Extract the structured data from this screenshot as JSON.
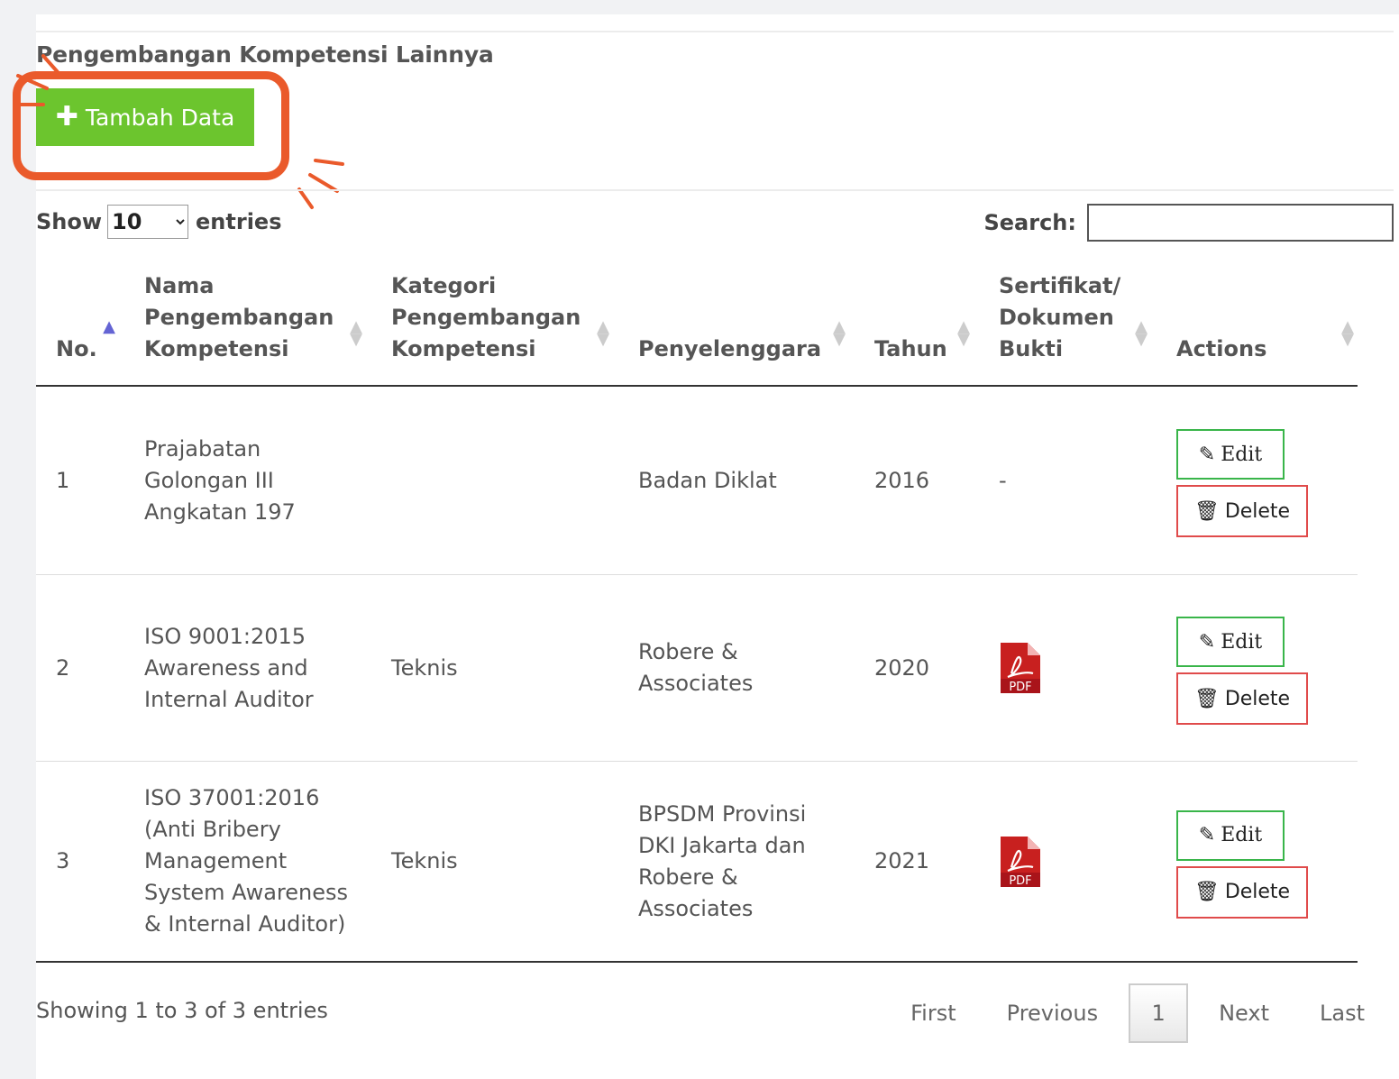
{
  "section": {
    "title": "Pengembangan Kompetensi Lainnya",
    "add_button_label": "Tambah Data",
    "highlight_color": "#ea5a2b",
    "add_button_color": "#6cc52e"
  },
  "controls": {
    "show_label": "Show",
    "entries_label": "entries",
    "page_length": "10",
    "search_label": "Search:",
    "search_value": ""
  },
  "table": {
    "headers": [
      {
        "label": "No.",
        "sort": "asc"
      },
      {
        "label": "Nama Pengembangan Kompetensi",
        "sort": "both"
      },
      {
        "label": "Kategori Pengembangan Kompetensi",
        "sort": "both"
      },
      {
        "label": "Penyelenggara",
        "sort": "both"
      },
      {
        "label": "Tahun",
        "sort": "both"
      },
      {
        "label": "Sertifikat/ Dokumen Bukti",
        "sort": "both"
      },
      {
        "label": "Actions",
        "sort": "both"
      }
    ],
    "rows": [
      {
        "no": "1",
        "nama": "Prajabatan Golongan III Angkatan 197",
        "kategori": "",
        "penyelenggara": "Badan Diklat",
        "tahun": "2016",
        "sertifikat": "-"
      },
      {
        "no": "2",
        "nama": "ISO 9001:2015 Awareness and Internal Auditor",
        "kategori": "Teknis",
        "penyelenggara": "Robere & Associates",
        "tahun": "2020",
        "pdf_label": "PDF"
      },
      {
        "no": "3",
        "nama": "ISO 37001:2016 (Anti Bribery Management System Awareness & Internal Auditor)",
        "kategori": "Teknis",
        "penyelenggara": "BPSDM Provinsi DKI Jakarta dan Robere & Associates",
        "tahun": "2021",
        "pdf_label": "PDF"
      }
    ],
    "edit_label": "Edit",
    "delete_label": "Delete"
  },
  "footer": {
    "info": "Showing 1 to 3 of 3 entries",
    "first": "First",
    "previous": "Previous",
    "current_page": "1",
    "next": "Next",
    "last": "Last"
  }
}
